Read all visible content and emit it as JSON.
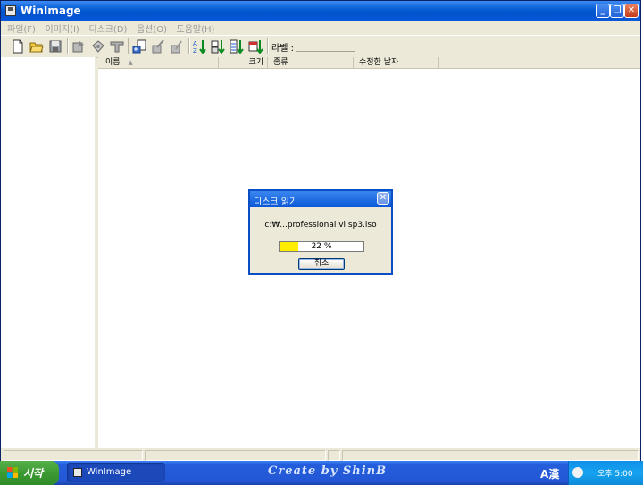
{
  "window": {
    "title": "WinImage",
    "buttons": {
      "minimize": "_",
      "restore": "❐",
      "close": "✕"
    }
  },
  "menu": [
    "파일(F)",
    "이미지(I)",
    "디스크(D)",
    "옵션(O)",
    "도움말(H)"
  ],
  "toolbar": {
    "label_text": "라벨 :",
    "label_value": "",
    "icons": [
      "new-icon",
      "open-icon",
      "save-icon",
      "inject-icon",
      "extract-icon",
      "delete-icon",
      "disk-read-icon",
      "write-icon",
      "format-icon",
      "sort-name-icon",
      "sort-type-icon",
      "sort-size-icon",
      "sort-date-icon"
    ]
  },
  "list": {
    "columns": [
      "이름",
      "크기",
      "종류",
      "수정한 날자"
    ],
    "sort_indicator": "▲",
    "rows": []
  },
  "dialog": {
    "title": "디스크 읽기",
    "close": "✕",
    "file": "c:₩...professional vl sp3.iso",
    "progress_percent": 22,
    "progress_text": "22 %",
    "cancel_label": "취소"
  },
  "taskbar": {
    "start_label": "시작",
    "task_label": "WinImage",
    "watermark": "Create by ShinB",
    "lang": "A漢",
    "clock": "오후 5:00"
  },
  "colors": {
    "titlebar": "#0a5fd6",
    "progress_fill": "#ffee00",
    "taskbar": "#245edb",
    "start_button": "#3c9a33"
  }
}
